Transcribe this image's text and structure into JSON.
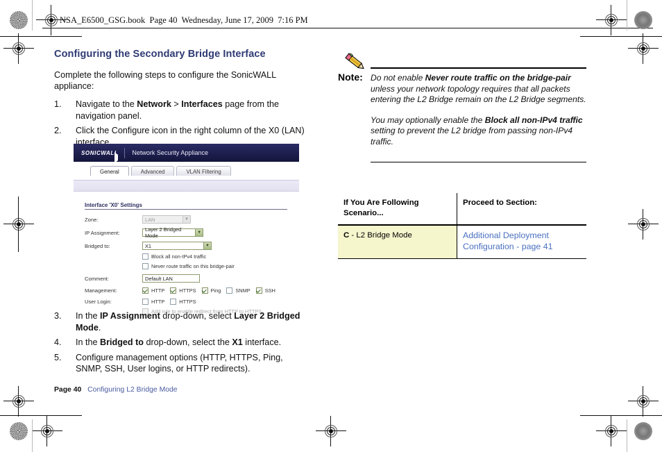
{
  "page_header": "NSA_E6500_GSG.book  Page 40  Wednesday, June 17, 2009  7:16 PM",
  "left_column": {
    "heading": "Configuring the Secondary Bridge Interface",
    "intro": "Complete the following steps to configure the SonicWALL appliance:",
    "steps": [
      {
        "num": "1.",
        "html": "Navigate to the <b>Network</b> > <b>Interfaces</b> page from the navigation panel."
      },
      {
        "num": "2.",
        "html": "Click the Configure icon in the right column of the X0 (LAN) interface."
      },
      {
        "num": "3.",
        "html": "In the <b>IP Assignment</b> drop-down, select <b>Layer 2 Bridged Mode</b>."
      },
      {
        "num": "4.",
        "html": "In the <b>Bridged to</b> drop-down, select the <b>X1</b> interface."
      },
      {
        "num": "5.",
        "html": "Configure management options (HTTP, HTTPS, Ping, SNMP, SSH, User logins, or HTTP redirects)."
      }
    ]
  },
  "screenshot": {
    "brand": "SONICWALL",
    "app_title": "Network Security Appliance",
    "tabs": [
      {
        "label": "General",
        "active": true
      },
      {
        "label": "Advanced",
        "active": false
      },
      {
        "label": "VLAN Filtering",
        "active": false
      }
    ],
    "panel_header": "Interface 'X0' Settings",
    "fields": [
      {
        "label": "Zone:",
        "value": "LAN",
        "type": "select",
        "disabled": true
      },
      {
        "label": "IP Assignment:",
        "value": "Layer 2 Bridged Mode",
        "type": "select",
        "disabled": false
      },
      {
        "label": "Bridged to:",
        "value": "X1",
        "type": "select",
        "disabled": false
      }
    ],
    "bridge_checkboxes": [
      {
        "label": "Block all non-IPv4 traffic",
        "checked": false
      },
      {
        "label": "Never route traffic on this bridge-pair",
        "checked": false
      }
    ],
    "comment": {
      "label": "Comment:",
      "value": "Default LAN"
    },
    "management": {
      "label": "Management:",
      "options": [
        {
          "label": "HTTP",
          "checked": true
        },
        {
          "label": "HTTPS",
          "checked": true
        },
        {
          "label": "Ping",
          "checked": true
        },
        {
          "label": "SNMP",
          "checked": false
        },
        {
          "label": "SSH",
          "checked": true
        }
      ]
    },
    "user_login": {
      "label": "User Login:",
      "options": [
        {
          "label": "HTTP",
          "checked": false
        },
        {
          "label": "HTTPS",
          "checked": false
        }
      ]
    },
    "redirect_rule": {
      "label": "Add rule to enable redirect from HTTP to HTTPS",
      "checked": false,
      "disabled": true
    }
  },
  "note": {
    "word": "Note:",
    "paragraph1_html": "Do not enable <b>Never route traffic on the bridge-pair</b> unless your network topology requires that all packets entering the L2 Bridge remain on the L2 Bridge segments.",
    "paragraph2_html": "You may optionally enable the <b>Block all non-IPv4 traffic</b> setting to prevent the L2 bridge from passing non-IPv4 traffic."
  },
  "scenario_table": {
    "headers": [
      "If You Are Following Scenario...",
      "Proceed to Section:"
    ],
    "rows": [
      {
        "scenario_html": "<b>C</b> - L2 Bridge Mode",
        "link": "Additional Deployment Configuration - page 41"
      }
    ]
  },
  "footer": {
    "page": "Page 40",
    "section": "Configuring L2 Bridge Mode"
  },
  "colors": {
    "heading": "#2e3a74",
    "link": "#4a6fbf",
    "banner": "#1d1e4e",
    "highlight_cell": "#f6f6cd",
    "field_border": "#8d9b6e"
  }
}
